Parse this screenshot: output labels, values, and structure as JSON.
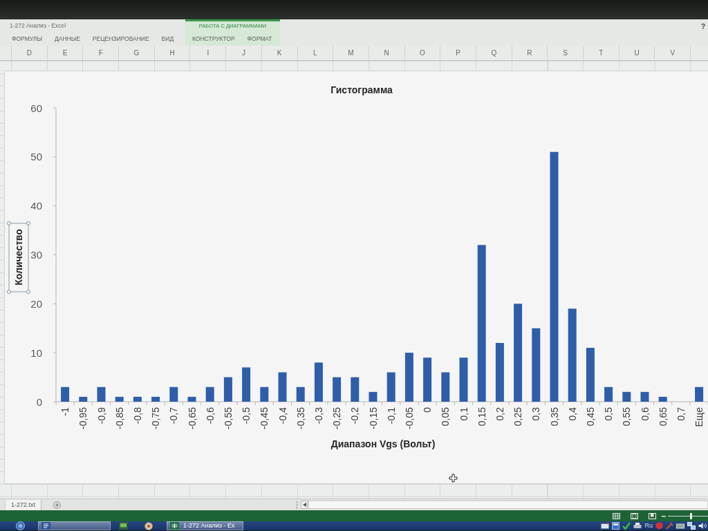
{
  "window": {
    "title": "1-272 Анализ - Excel",
    "help": "?"
  },
  "ribbon": {
    "tabs": [
      {
        "label": "ФОРМУЛЫ",
        "selected": false
      },
      {
        "label": "ДАННЫЕ",
        "selected": false
      },
      {
        "label": "РЕЦЕНЗИРОВАНИЕ",
        "selected": false
      },
      {
        "label": "ВИД",
        "selected": false
      }
    ],
    "chart_tools": {
      "title": "РАБОТА С ДИАГРАММАМИ",
      "tabs": [
        {
          "label": "КОНСТРУКТОР",
          "selected": false
        },
        {
          "label": "ФОРМАТ",
          "selected": false
        }
      ]
    }
  },
  "columns": [
    "D",
    "E",
    "F",
    "G",
    "H",
    "I",
    "J",
    "K",
    "L",
    "M",
    "N",
    "O",
    "P",
    "Q",
    "R",
    "S",
    "T",
    "U",
    "V"
  ],
  "chart": {
    "y_axis_title_selected": true,
    "chart_data": {
      "type": "bar",
      "title": "Гистограмма",
      "xlabel": "Диапазон Vgs (Вольт)",
      "ylabel": "Количество",
      "categories": [
        "-1",
        "-0,95",
        "-0,9",
        "-0,85",
        "-0,8",
        "-0,75",
        "-0,7",
        "-0,65",
        "-0,6",
        "-0,55",
        "-0,5",
        "-0,45",
        "-0,4",
        "-0,35",
        "-0,3",
        "-0,25",
        "-0,2",
        "-0,15",
        "-0,1",
        "-0,05",
        "0",
        "0,05",
        "0,1",
        "0,15",
        "0,2",
        "0,25",
        "0,3",
        "0,35",
        "0,4",
        "0,45",
        "0,5",
        "0,55",
        "0,6",
        "0,65",
        "0,7",
        "Еще"
      ],
      "series": [
        {
          "color": "#2e5ea8",
          "values": [
            3,
            1,
            3,
            1,
            1,
            1,
            3,
            1,
            3,
            5,
            7,
            3,
            6,
            3,
            8,
            5,
            5,
            2,
            6,
            10,
            9,
            6,
            9,
            32,
            12,
            20,
            15,
            51,
            19,
            11,
            3,
            2,
            2,
            1,
            0,
            3
          ]
        }
      ],
      "ylim": [
        0,
        60
      ],
      "yticks": [
        0,
        10,
        20,
        30,
        40,
        50,
        60
      ]
    }
  },
  "sheet_tabs": [
    {
      "label": "1-272.txt",
      "selected": true
    }
  ],
  "status_bar": {
    "zoom": {
      "level": 0.58
    }
  },
  "taskbar": {
    "buttons": [
      {
        "kind": "word",
        "running": true
      },
      {
        "kind": "media",
        "running": false
      },
      {
        "kind": "disc",
        "running": false
      },
      {
        "kind": "excel",
        "running": true,
        "label": "1-272 Анализ - Ex"
      }
    ],
    "tray": {
      "language": "Ru"
    }
  }
}
